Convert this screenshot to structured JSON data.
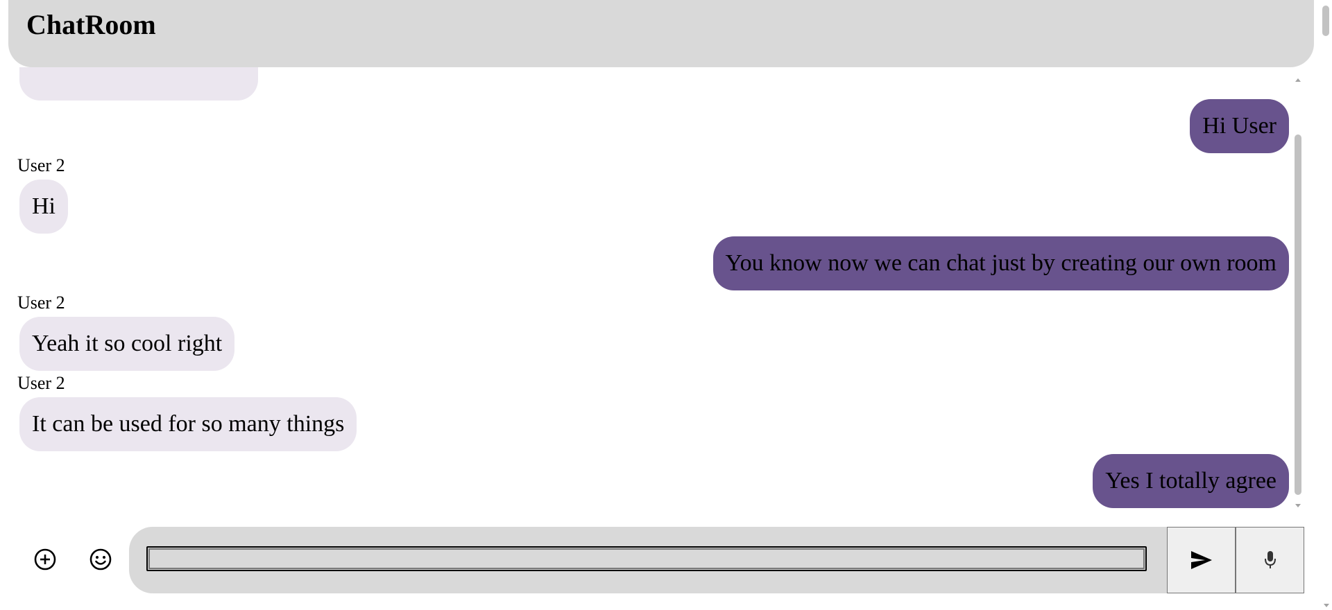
{
  "header": {
    "title": "ChatRoom"
  },
  "messages": [
    {
      "direction": "out",
      "text": "Hi User"
    },
    {
      "direction": "in",
      "sender": "User 2",
      "text": "Hi"
    },
    {
      "direction": "out",
      "text": "You know now we can chat just by creating our own room"
    },
    {
      "direction": "in",
      "sender": "User 2",
      "text": "Yeah it so cool right"
    },
    {
      "direction": "in",
      "sender": "User 2",
      "text": "It can be used for so many things"
    },
    {
      "direction": "out",
      "text": "Yes I totally agree"
    }
  ],
  "composer": {
    "input_value": "",
    "attach_icon": "plus-circle-icon",
    "emoji_icon": "smiley-icon",
    "send_icon": "send-icon",
    "mic_icon": "microphone-icon"
  },
  "colors": {
    "header_bg": "#d9d9d9",
    "incoming_bubble": "#ebe6ef",
    "outgoing_bubble": "#68538d",
    "composer_bg": "#d9d9d9"
  }
}
